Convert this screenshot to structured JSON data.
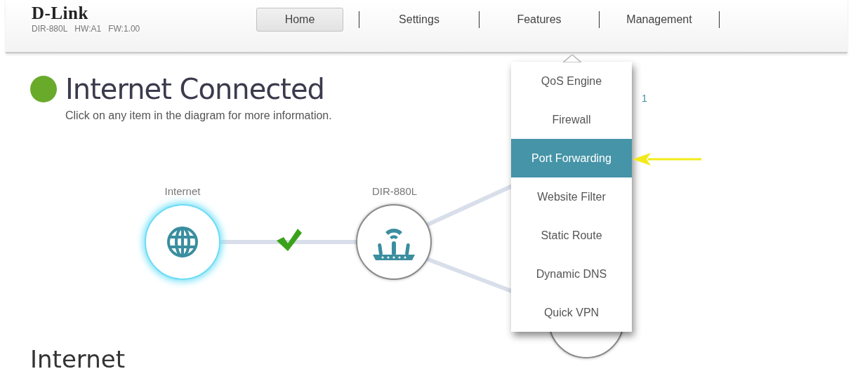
{
  "header": {
    "logo": "D-Link",
    "model": "DIR-880L",
    "hardware": "HW:A1",
    "firmware": "FW:1.00"
  },
  "nav": [
    {
      "label": "Home",
      "selected": true
    },
    {
      "label": "Settings",
      "selected": false
    },
    {
      "label": "Features",
      "selected": false,
      "expanded": true
    },
    {
      "label": "Management",
      "selected": false
    }
  ],
  "features_menu": [
    {
      "label": "QoS Engine",
      "selected": false
    },
    {
      "label": "Firewall",
      "selected": false
    },
    {
      "label": "Port Forwarding",
      "selected": true
    },
    {
      "label": "Website Filter",
      "selected": false
    },
    {
      "label": "Static Route",
      "selected": false
    },
    {
      "label": "Dynamic DNS",
      "selected": false
    },
    {
      "label": "Quick VPN",
      "selected": false
    }
  ],
  "status": {
    "title": "Internet Connected",
    "connected": true,
    "hint": "Click on any item in the diagram for more information."
  },
  "diagram": {
    "nodes": [
      {
        "kind": "internet",
        "label": "Internet",
        "selected": true
      },
      {
        "kind": "router",
        "label": "DIR-880L",
        "selected": false
      },
      {
        "kind": "client",
        "selected": false
      }
    ],
    "link_ok": true,
    "partial_text": "1"
  },
  "section_title": "Internet"
}
